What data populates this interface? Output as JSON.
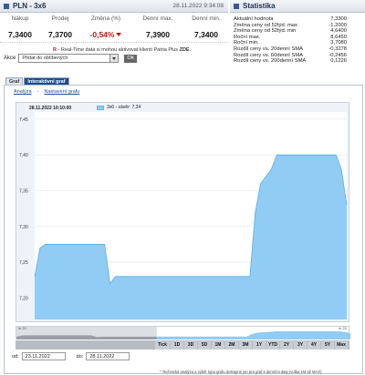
{
  "header": {
    "title": "PLN - 3x6",
    "timestamp": "28.11.2022 9:34:08",
    "stats_title": "Statistika"
  },
  "quote": {
    "labels": [
      "Nákup",
      "Prodej",
      "Změna (%)",
      "Denní max.",
      "Denní min."
    ],
    "values": [
      "7,3400",
      "7,3700",
      "-0,54%",
      "7,3900",
      "7,3400"
    ]
  },
  "realtime_note": {
    "prefix": "R",
    "text": " - Real-Time data si mohou aktivovat klienti Patria Plus ",
    "link": "ZDE",
    "suffix": "."
  },
  "akce": {
    "label": "Akce",
    "selected": "Přidat do oblíbených",
    "go": "OK"
  },
  "stats": [
    {
      "label": "Aktuální hodnota",
      "value": "7,3300"
    },
    {
      "label": "Změna ceny od 52týd. max",
      "value": "-1,2000"
    },
    {
      "label": "Změna ceny od 52týd. min",
      "value": "4,6400"
    },
    {
      "label": "Roční max.",
      "value": "8,6450"
    },
    {
      "label": "Roční min.",
      "value": "3,7080"
    },
    {
      "label": "Rozdíl ceny vs. 20denní SMA",
      "value": "-0,3278"
    },
    {
      "label": "Rozdíl ceny vs. 60denní SMA",
      "value": "-0,2456"
    },
    {
      "label": "Rozdíl ceny vs. 200denní SMA",
      "value": "0,1226"
    }
  ],
  "tabs": [
    "Graf",
    "Interaktivní graf"
  ],
  "chart_links": [
    "Analýza",
    "Nastavení grafu"
  ],
  "chart_date": "28.11.2022 10:10:00",
  "legend_label": "3x6 - závěr: 7,34",
  "colors": {
    "fill": "#90ccf4",
    "line": "#5aaee6",
    "chart_bg": "#eef3f9"
  },
  "chart_data": {
    "type": "area",
    "ylim": [
      7.17,
      7.46
    ],
    "y_ticks": [
      "7,45",
      "7,40",
      "7,35",
      "7,30",
      "7,25",
      "7,20"
    ],
    "y_tick_values": [
      7.45,
      7.4,
      7.35,
      7.3,
      7.25,
      7.2
    ],
    "values": [
      7.23,
      7.27,
      7.275,
      7.275,
      7.275,
      7.275,
      7.275,
      7.275,
      7.275,
      7.275,
      7.275,
      7.275,
      7.275,
      7.275,
      7.22,
      7.23,
      7.23,
      7.23,
      7.23,
      7.23,
      7.23,
      7.23,
      7.23,
      7.23,
      7.23,
      7.23,
      7.23,
      7.23,
      7.23,
      7.23,
      7.23,
      7.23,
      7.23,
      7.23,
      7.23,
      7.23,
      7.23,
      7.23,
      7.23,
      7.23,
      7.23,
      7.32,
      7.36,
      7.37,
      7.38,
      7.4,
      7.4,
      7.4,
      7.4,
      7.4,
      7.4,
      7.4,
      7.4,
      7.4,
      7.4,
      7.4,
      7.4,
      7.38,
      7.33
    ]
  },
  "navigator": {
    "left_label": "le 20",
    "right_label": "le 20"
  },
  "range_buttons": [
    "Tick",
    "1D",
    "3D",
    "5D",
    "1M",
    "2M",
    "3M",
    "1Y",
    "YTD",
    "2Y",
    "3Y",
    "4Y",
    "5Y",
    "Max"
  ],
  "dates": {
    "from_label": "od:",
    "from": "23.11.2022",
    "to_label": "do:",
    "to": "28.11.2022"
  },
  "footnote": "* Technická analýza a výběr typu grafu dostupné jen pro graf s denními daty (volba 1M až MAX)"
}
